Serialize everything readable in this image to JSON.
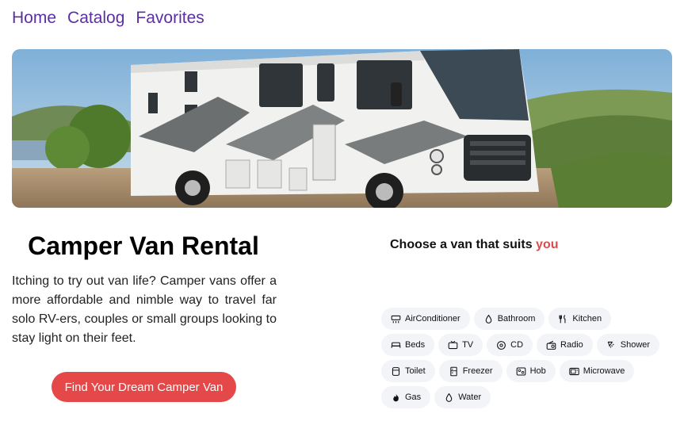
{
  "nav": {
    "home": "Home",
    "catalog": "Catalog",
    "favorites": "Favorites"
  },
  "hero": {
    "title": "Camper Van Rental",
    "description": "Itching to try out van life? Camper vans offer a more affordable and nimble way to travel far solo RV-ers, couples or small groups looking to stay light on their feet.",
    "cta_label": "Find Your Dream Camper Van"
  },
  "choose": {
    "text": "Choose a van that suits ",
    "accent": "you"
  },
  "features": [
    {
      "label": "AirConditioner",
      "icon": "air-conditioner-icon"
    },
    {
      "label": "Bathroom",
      "icon": "water-drop-icon"
    },
    {
      "label": "Kitchen",
      "icon": "cutlery-icon"
    },
    {
      "label": "Beds",
      "icon": "bed-icon"
    },
    {
      "label": "TV",
      "icon": "tv-icon"
    },
    {
      "label": "CD",
      "icon": "cd-icon"
    },
    {
      "label": "Radio",
      "icon": "radio-icon"
    },
    {
      "label": "Shower",
      "icon": "shower-icon"
    },
    {
      "label": "Toilet",
      "icon": "toilet-icon"
    },
    {
      "label": "Freezer",
      "icon": "freezer-icon"
    },
    {
      "label": "Hob",
      "icon": "hob-icon"
    },
    {
      "label": "Microwave",
      "icon": "microwave-icon"
    },
    {
      "label": "Gas",
      "icon": "flame-icon"
    },
    {
      "label": "Water",
      "icon": "water-drop-icon"
    }
  ],
  "colors": {
    "accent": "#e44848",
    "nav_link": "#5b2fa3",
    "chip_bg": "#f2f4f7"
  }
}
